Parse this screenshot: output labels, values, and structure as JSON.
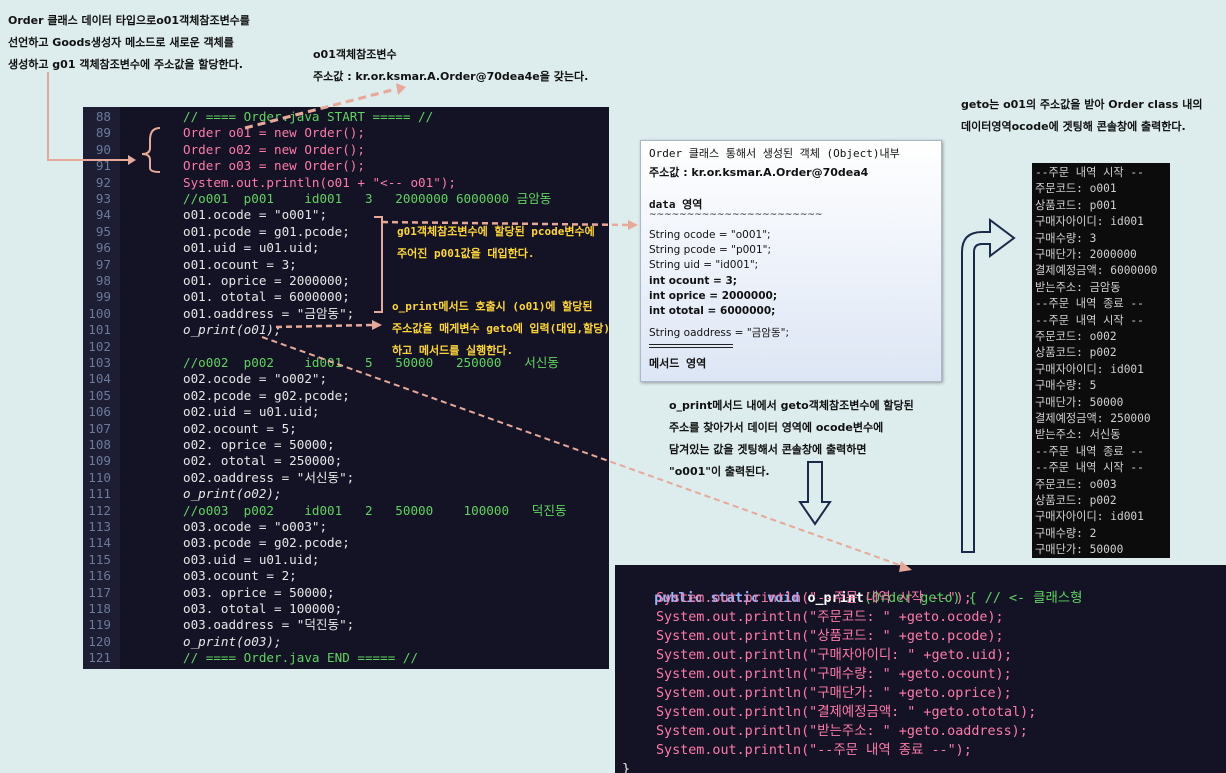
{
  "notes": {
    "top_left": [
      "Order 클래스 데이터 타입으로o01객체참조변수를",
      "선언하고 Goods생성자 메소드로 새로운 객체를",
      "생성하고   g01 객체참조변수에 주소값을 할당한다."
    ],
    "top_mid": [
      "o01객체참조변수",
      "주소값 : kr.or.ksmar.A.Order@70dea4e을  갖는다."
    ],
    "top_right": [
      "geto는 o01의 주소값을 받아 Order class 내의",
      "데이터영역ocode에 겟팅해 콘솔창에 출력한다."
    ],
    "mid_right": [
      "o_print메서드 내에서 geto객체참조변수에 할당된",
      "주소를 찾아가서 데이터 영역에 ocode변수에",
      "담겨있는 값을 겟팅해서 콘솔창에 출력하면",
      "\"o001\"이 출력된다."
    ]
  },
  "annotations": {
    "pcode": [
      "g01객체참조변수에  할당된 pcode변수에",
      "주어진 p001값을 대입한다."
    ],
    "print": [
      "o_print메서드 호출시 (o01)에 할당된",
      "주소값을 매게변수 geto에 입력(대입,할당)",
      "하고 메서드를 실행한다."
    ]
  },
  "object_box": {
    "title": "Order 클래스 통해서 생성된 객체 (Object)내부",
    "address": "주소값 :  kr.or.ksmar.A.Order@70dea4",
    "data_label": "data 영역",
    "divider": "~~~~~~~~~~~~~~~~~~~~~~~",
    "fields": [
      "String ocode = \"o001\";",
      "String pcode = \"p001\";",
      "String uid = \"id001\";",
      "int ocount  = 3;",
      "int oprice  = 2000000;",
      "int ototal  = 6000000;",
      "String oaddress = \"금암동\";"
    ],
    "method_label": "메서드 영역"
  },
  "code_lines": [
    {
      "n": "88",
      "t": "// ==== Order.java START ===== //"
    },
    {
      "n": "89",
      "t": "Order o01 = new Order();"
    },
    {
      "n": "90",
      "t": "Order o02 = new Order();"
    },
    {
      "n": "91",
      "t": "Order o03 = new Order();"
    },
    {
      "n": "92",
      "t": "System.out.println(o01 + \"<-- o01\");"
    },
    {
      "n": "93",
      "t": "//o001  p001    id001   3   2000000 6000000 금암동"
    },
    {
      "n": "94",
      "t": "o01.ocode = \"o001\";"
    },
    {
      "n": "95",
      "t": "o01.pcode = g01.pcode;"
    },
    {
      "n": "96",
      "t": "o01.uid = u01.uid;"
    },
    {
      "n": "97",
      "t": "o01.ocount = 3;"
    },
    {
      "n": "98",
      "t": "o01. oprice = 2000000;"
    },
    {
      "n": "99",
      "t": "o01. ototal = 6000000;"
    },
    {
      "n": "100",
      "t": "o01.oaddress = \"금암동\";"
    },
    {
      "n": "101",
      "t": "o_print(o01);"
    },
    {
      "n": "102",
      "t": ""
    },
    {
      "n": "103",
      "t": "//o002  p002    id001   5   50000   250000   서신동"
    },
    {
      "n": "104",
      "t": "o02.ocode = \"o002\";"
    },
    {
      "n": "105",
      "t": "o02.pcode = g02.pcode;"
    },
    {
      "n": "106",
      "t": "o02.uid = u01.uid;"
    },
    {
      "n": "107",
      "t": "o02.ocount = 5;"
    },
    {
      "n": "108",
      "t": "o02. oprice = 50000;"
    },
    {
      "n": "109",
      "t": "o02. ototal = 250000;"
    },
    {
      "n": "110",
      "t": "o02.oaddress = \"서신동\";"
    },
    {
      "n": "111",
      "t": "o_print(o02);"
    },
    {
      "n": "112",
      "t": "//o003  p002    id001   2   50000    100000   덕진동"
    },
    {
      "n": "113",
      "t": "o03.ocode = \"o003\";"
    },
    {
      "n": "114",
      "t": "o03.pcode = g02.pcode;"
    },
    {
      "n": "115",
      "t": "o03.uid = u01.uid;"
    },
    {
      "n": "116",
      "t": "o03.ocount = 2;"
    },
    {
      "n": "117",
      "t": "o03. oprice = 50000;"
    },
    {
      "n": "118",
      "t": "o03. ototal = 100000;"
    },
    {
      "n": "119",
      "t": "o03.oaddress = \"덕진동\";"
    },
    {
      "n": "120",
      "t": "o_print(o03);"
    },
    {
      "n": "121",
      "t": "// ==== Order.java END ===== //"
    }
  ],
  "console_lines": [
    "--주문 내역 시작 --",
    "주문코드: o001",
    "상품코드: p001",
    "구매자아이디: id001",
    "구매수량: 3",
    "구매단가: 2000000",
    "결제예정금액: 6000000",
    "받는주소: 금암동",
    "--주문 내역 종료 --",
    "--주문 내역 시작 --",
    "주문코드: o002",
    "상품코드: p002",
    "구매자아이디: id001",
    "구매수량: 5",
    "구매단가: 50000",
    "결제예정금액: 250000",
    "받는주소: 서신동",
    "--주문 내역 종료 --",
    "--주문 내역 시작 --",
    "주문코드: o003",
    "상품코드: p002",
    "구매자아이디: id001",
    "구매수량: 2",
    "구매단가: 50000"
  ],
  "method_code": {
    "header_a": "public static void ",
    "header_b": "o_print",
    "header_c": "(Order geto) { // <- 클래스형",
    "lines": [
      "System.out.println(\"--주문 내역 시작 --\");",
      "System.out.println(\"주문코드: \" +geto.ocode);",
      "System.out.println(\"상품코드: \" +geto.pcode);",
      "System.out.println(\"구매자아이디: \" +geto.uid);",
      "System.out.println(\"구매수량: \" +geto.ocount);",
      "System.out.println(\"구매단가: \" +geto.oprice);",
      "System.out.println(\"결제예정금액: \" +geto.ototal);",
      "System.out.println(\"받는주소: \" +geto.oaddress);",
      "System.out.println(\"--주문 내역 종료 --\");"
    ],
    "close": "}"
  },
  "colors": {
    "arrow": "#e8a898",
    "code_bg": "#131325",
    "keyword": "#ff7aa8",
    "comment": "#5fd35f",
    "navy_arrow": "#1a2a4a"
  }
}
